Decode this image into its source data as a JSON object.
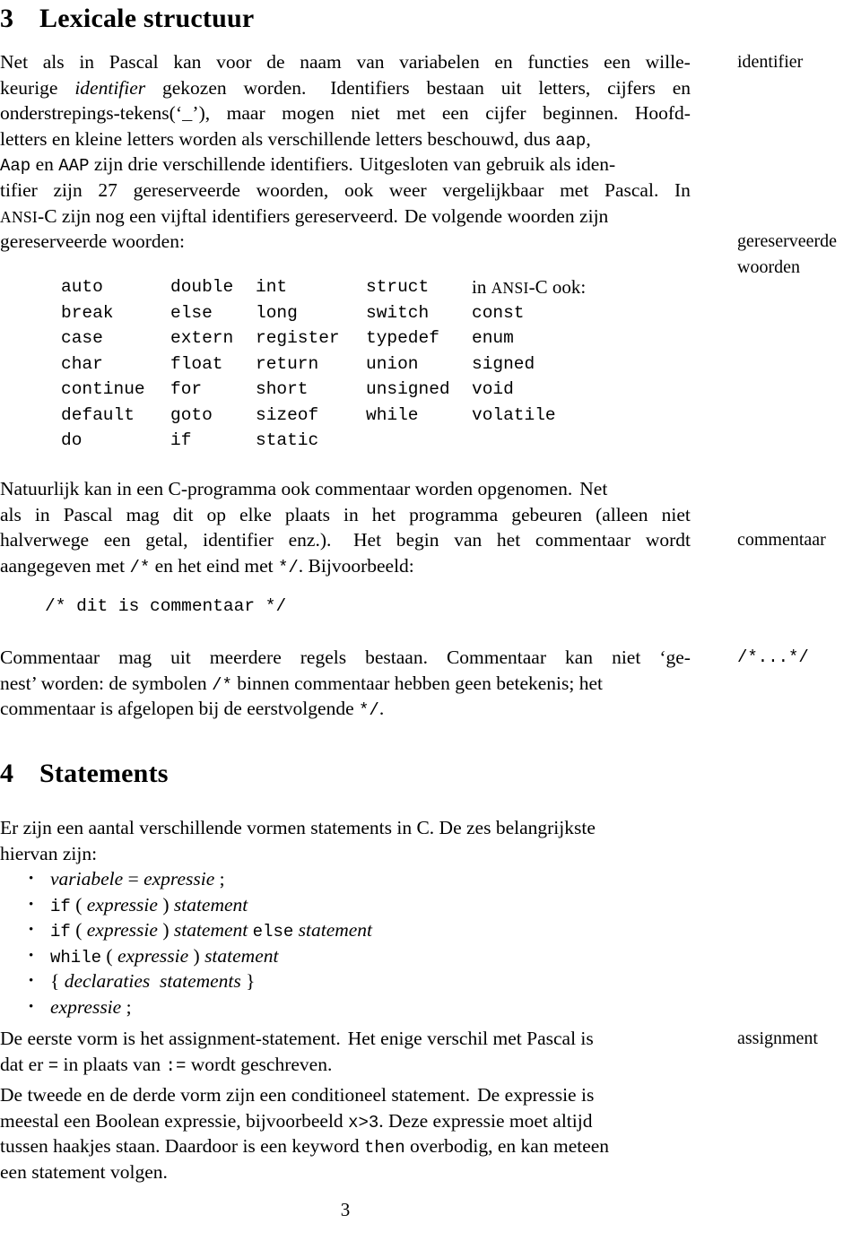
{
  "document": {
    "page_number": "3"
  },
  "sections": {
    "lexicale": {
      "number": "3",
      "title": "Lexicale structuur"
    },
    "statements": {
      "number": "4",
      "title": "Statements"
    }
  },
  "margin_notes": {
    "identifier": "identifier",
    "gereserveerde": "gereserveerde",
    "woorden": "woorden",
    "commentaar": "commentaar",
    "comment_syntax": "/*...*/",
    "assignment": "assignment"
  },
  "paragraph_identifiers": {
    "l1": {
      "a": "Net",
      "b": "als",
      "c": "in",
      "d": "Pascal",
      "e": "kan",
      "f": "voor",
      "g": "de",
      "h": "naam",
      "i": "van",
      "j": "variabelen",
      "k": "en",
      "l": "functies",
      "m": "een",
      "n": "wille-"
    },
    "l2": {
      "a": "keurige",
      "b": "identifier",
      "c": "gekozen",
      "d": "worden.",
      "e": "Identifiers",
      "f": "bestaan",
      "g": "uit",
      "h": "letters,",
      "i": "cijfers",
      "j": "en"
    },
    "l3": {
      "a": "onderstrepings-tekens",
      "b": "(‘",
      "c": "_",
      "d": "’),",
      "e": "maar",
      "f": "mogen",
      "g": "niet",
      "h": "met",
      "i": "een",
      "j": "cijfer",
      "k": "beginnen.",
      "l": "Hoofd-"
    },
    "l4": {
      "a": "letters en kleine letters worden als verschillende letters beschouwd, dus ",
      "b": "aap",
      "c": ","
    },
    "l5": {
      "a": "Aap",
      "b": " en ",
      "c": "AAP",
      "d": " zijn drie verschillende identifiers.",
      "e": "Uitgesloten van gebruik als iden-"
    },
    "l6": {
      "a": "tifier",
      "b": "zijn",
      "c": "27",
      "d": "gereserveerde",
      "e": "woorden,",
      "f": "ook",
      "g": "weer",
      "h": "vergelijkbaar",
      "i": "met",
      "j": "Pascal.",
      "k": "In"
    },
    "l7": {
      "a": "ANSI",
      "b": "-C zijn nog een vijftal identifiers gereserveerd.",
      "c": "De volgende woorden zijn"
    },
    "l8": {
      "a": "gereserveerde woorden:"
    }
  },
  "keyword_table": {
    "ansi_label_prefix": "in ",
    "ansi_label_sc": "ANSI",
    "ansi_label_suffix": "-C ook:",
    "rows": [
      {
        "c0": "auto",
        "c1": "double",
        "c2": "int",
        "c3": "struct",
        "c4": ""
      },
      {
        "c0": "break",
        "c1": "else",
        "c2": "long",
        "c3": "switch",
        "c4": "const"
      },
      {
        "c0": "case",
        "c1": "extern",
        "c2": "register",
        "c3": "typedef",
        "c4": "enum"
      },
      {
        "c0": "char",
        "c1": "float",
        "c2": "return",
        "c3": "union",
        "c4": "signed"
      },
      {
        "c0": "continue",
        "c1": "for",
        "c2": "short",
        "c3": "unsigned",
        "c4": "void"
      },
      {
        "c0": "default",
        "c1": "goto",
        "c2": "sizeof",
        "c3": "while",
        "c4": "volatile"
      },
      {
        "c0": "do",
        "c1": "if",
        "c2": "static",
        "c3": "",
        "c4": ""
      }
    ]
  },
  "paragraph_commentaar": {
    "l1": {
      "a": "Natuurlijk kan in een C-programma ook commentaar worden opgenomen.",
      "b": "Net"
    },
    "l2": {
      "a": "als",
      "b": "in",
      "c": "Pascal",
      "d": "mag",
      "e": "dit",
      "f": "op",
      "g": "elke",
      "h": "plaats",
      "i": "in",
      "j": "het",
      "k": "programma",
      "l": "gebeuren",
      "m": "(alleen",
      "n": "niet"
    },
    "l3": {
      "a": "halverwege",
      "b": "een",
      "c": "getal,",
      "d": "identifier",
      "e": "enz.).",
      "f": "Het",
      "g": "begin",
      "h": "van",
      "i": "het",
      "j": "commentaar",
      "k": "wordt"
    },
    "l4": {
      "a": "aangegeven met ",
      "b": "/*",
      "c": " en het eind met ",
      "d": "*/",
      "e": ". Bijvoorbeeld:"
    }
  },
  "code_comment_example": "/* dit is commentaar */",
  "paragraph_nesting": {
    "l1": {
      "a": "Commentaar",
      "b": "mag",
      "c": "uit",
      "d": "meerdere",
      "e": "regels",
      "f": "bestaan.",
      "g": "Commentaar",
      "h": "kan",
      "i": "niet",
      "j": "‘ge-"
    },
    "l2": {
      "a": "nest’ worden: de symbolen ",
      "b": "/*",
      "c": " binnen commentaar hebben geen betekenis; het"
    },
    "l3": {
      "a": "commentaar is afgelopen bij de eerstvolgende ",
      "b": "*/",
      "c": "."
    }
  },
  "paragraph_statements_intro": {
    "l1": "Er zijn een aantal verschillende vormen statements in C. De zes belangrijkste",
    "l2": "hiervan zijn:"
  },
  "statement_forms": [
    {
      "bullet": "•",
      "parts": [
        {
          "t": "variabele",
          "s": "it"
        },
        {
          "t": " = ",
          "s": "plain"
        },
        {
          "t": "expressie",
          "s": "it"
        },
        {
          "t": " ;",
          "s": "plain"
        }
      ]
    },
    {
      "bullet": "•",
      "parts": [
        {
          "t": "if",
          "s": "tt"
        },
        {
          "t": " ( ",
          "s": "plain"
        },
        {
          "t": "expressie",
          "s": "it"
        },
        {
          "t": " ) ",
          "s": "plain"
        },
        {
          "t": "statement",
          "s": "it"
        }
      ]
    },
    {
      "bullet": "•",
      "parts": [
        {
          "t": "if",
          "s": "tt"
        },
        {
          "t": " ( ",
          "s": "plain"
        },
        {
          "t": "expressie",
          "s": "it"
        },
        {
          "t": " ) ",
          "s": "plain"
        },
        {
          "t": "statement",
          "s": "it"
        },
        {
          "t": " ",
          "s": "plain"
        },
        {
          "t": "else",
          "s": "tt"
        },
        {
          "t": " ",
          "s": "plain"
        },
        {
          "t": "statement",
          "s": "it"
        }
      ]
    },
    {
      "bullet": "•",
      "parts": [
        {
          "t": "while",
          "s": "tt"
        },
        {
          "t": " ( ",
          "s": "plain"
        },
        {
          "t": "expressie",
          "s": "it"
        },
        {
          "t": " ) ",
          "s": "plain"
        },
        {
          "t": "statement",
          "s": "it"
        }
      ]
    },
    {
      "bullet": "•",
      "parts": [
        {
          "t": "{ ",
          "s": "plain"
        },
        {
          "t": "declaraties",
          "s": "it"
        },
        {
          "t": "  ",
          "s": "plain"
        },
        {
          "t": "statements",
          "s": "it"
        },
        {
          "t": " }",
          "s": "plain"
        }
      ]
    },
    {
      "bullet": "•",
      "parts": [
        {
          "t": "expressie",
          "s": "it"
        },
        {
          "t": " ;",
          "s": "plain"
        }
      ]
    }
  ],
  "paragraph_assignment": {
    "l1": {
      "a": "De eerste vorm is het assignment-statement.",
      "b": "Het enige verschil met Pascal is"
    },
    "l2": {
      "a": "dat er ",
      "b": "=",
      "c": " in plaats van ",
      "d": ":=",
      "e": " wordt geschreven."
    }
  },
  "paragraph_conditional": {
    "l1": {
      "a": "De tweede en de derde vorm zijn een conditioneel statement.",
      "b": "De expressie is"
    },
    "l2": {
      "a": "meestal een Boolean expressie, bijvoorbeeld ",
      "b": "x>3",
      "c": ". Deze expressie moet altijd"
    },
    "l3": {
      "a": "tussen haakjes staan. Daardoor is een keyword ",
      "b": "then",
      "c": " overbodig, en kan meteen"
    },
    "l4": {
      "a": "een statement volgen."
    }
  }
}
